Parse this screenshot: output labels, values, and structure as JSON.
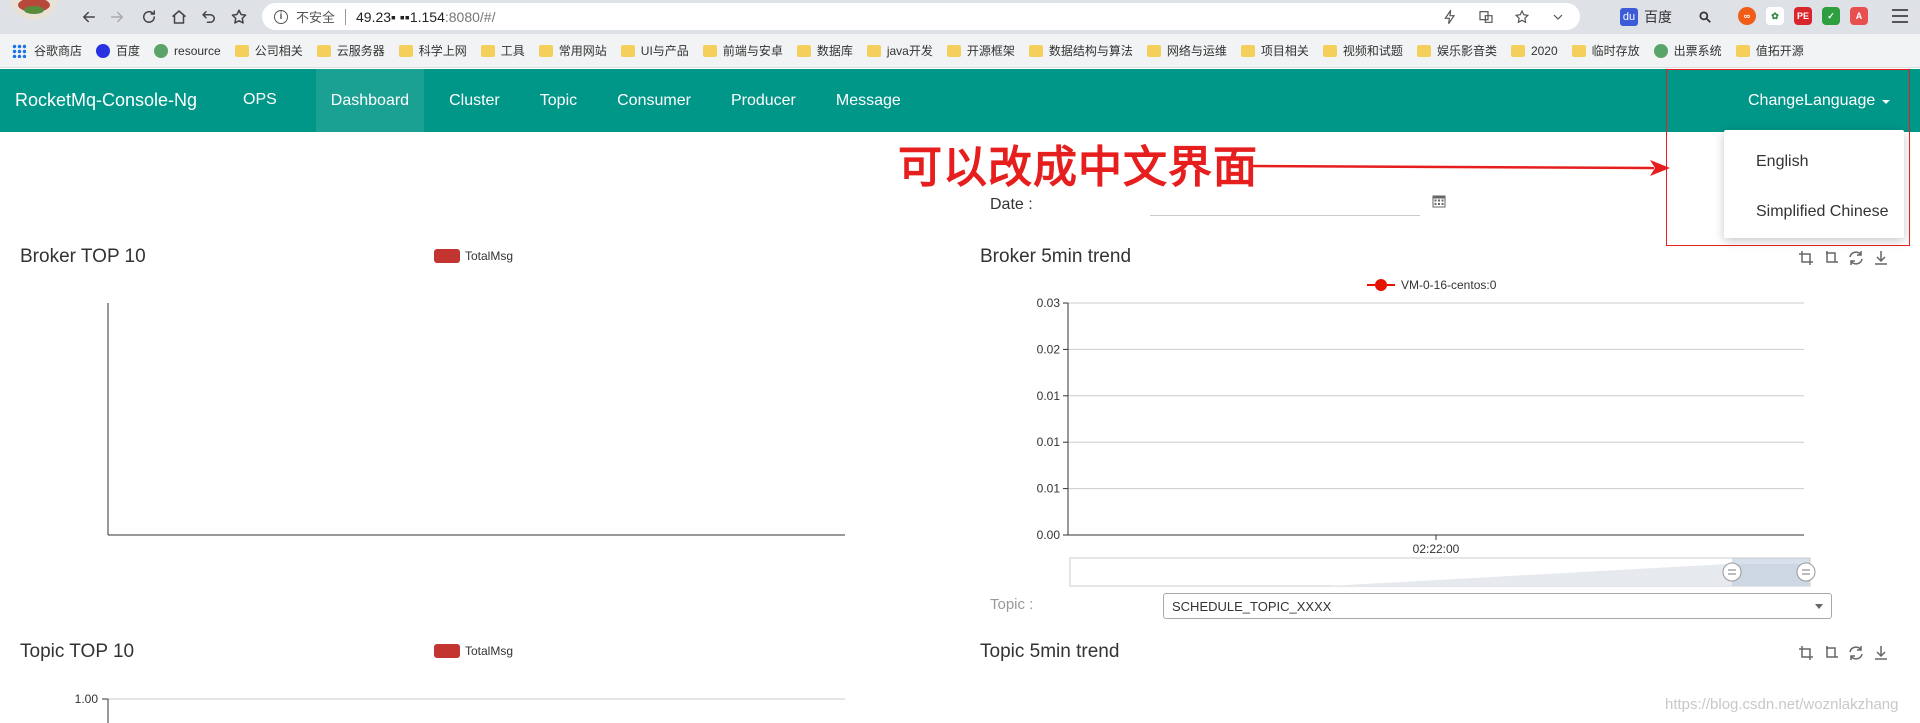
{
  "browser": {
    "insecure_label": "不安全",
    "url_host": "49.23▪ ▪▪1.154",
    "url_path": ":8080/#/",
    "search_engine": "百度",
    "bookmarks": [
      "谷歌商店",
      "百度",
      "resource",
      "公司相关",
      "云服务器",
      "科学上网",
      "工具",
      "常用网站",
      "UI与产品",
      "前端与安卓",
      "数据库",
      "java开发",
      "开源框架",
      "数据结构与算法",
      "网络与运维",
      "项目相关",
      "视频和试题",
      "娱乐影音类",
      "2020",
      "临时存放",
      "出票系统",
      "值拓开源"
    ]
  },
  "navbar": {
    "brand": "RocketMq-Console-Ng",
    "items": [
      "OPS",
      "Dashboard",
      "Cluster",
      "Topic",
      "Consumer",
      "Producer",
      "Message"
    ],
    "active": "Dashboard",
    "language_label": "ChangeLanguage",
    "language_options": [
      "English",
      "Simplified Chinese"
    ]
  },
  "annotation": {
    "text": "可以改成中文界面",
    "color": "#e61e1e"
  },
  "date": {
    "label": "Date :",
    "value": ""
  },
  "colors": {
    "navbar": "#009688",
    "navbar_active": "#1aa193",
    "series_bar": "#c23531",
    "series_line": "#e51400"
  },
  "panels": {
    "broker_top": {
      "title": "Broker TOP 10",
      "legend": "TotalMsg"
    },
    "broker_trend": {
      "title": "Broker 5min trend",
      "legend": "VM-0-16-centos:0"
    },
    "topic_top": {
      "title": "Topic TOP 10",
      "legend": "TotalMsg"
    },
    "topic_trend": {
      "title": "Topic 5min trend"
    }
  },
  "topic": {
    "label": "Topic :",
    "selected": "SCHEDULE_TOPIC_XXXX"
  },
  "watermark": "https://blog.csdn.net/woznlakzhang",
  "chart_data": [
    {
      "id": "broker_top",
      "type": "bar",
      "title": "Broker TOP 10",
      "series": [
        {
          "name": "TotalMsg",
          "values": []
        }
      ],
      "categories": []
    },
    {
      "id": "broker_trend",
      "type": "line",
      "title": "Broker 5min trend",
      "x": [
        "02:22:00"
      ],
      "series": [
        {
          "name": "VM-0-16-centos:0",
          "values": []
        }
      ],
      "y_ticks": [
        "0.00",
        "0.01",
        "0.01",
        "0.01",
        "0.02",
        "0.03"
      ],
      "grid": true,
      "data_zoom": [
        0.9,
        1.0
      ]
    },
    {
      "id": "topic_top",
      "type": "bar",
      "title": "Topic TOP 10",
      "series": [
        {
          "name": "TotalMsg",
          "values": []
        }
      ],
      "y_ticks": [
        "1.00"
      ]
    }
  ]
}
